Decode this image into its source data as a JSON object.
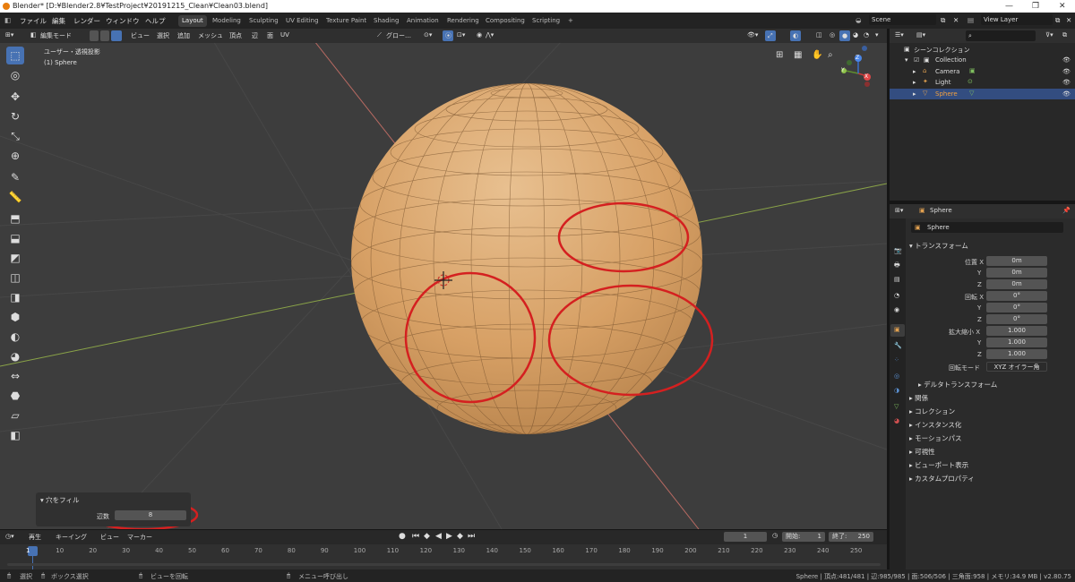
{
  "window": {
    "title": "Blender* [D:¥Blender2.8¥TestProject¥20191215_Clean¥Clean03.blend]"
  },
  "menu": [
    "ファイル",
    "編集",
    "レンダー",
    "ウィンドウ",
    "ヘルプ"
  ],
  "workspaces": [
    {
      "label": "Layout",
      "active": true
    },
    {
      "label": "Modeling"
    },
    {
      "label": "Sculpting"
    },
    {
      "label": "UV Editing"
    },
    {
      "label": "Texture Paint"
    },
    {
      "label": "Shading"
    },
    {
      "label": "Animation"
    },
    {
      "label": "Rendering"
    },
    {
      "label": "Compositing"
    },
    {
      "label": "Scripting"
    },
    {
      "label": "+"
    }
  ],
  "scene": "Scene",
  "view_layer": "View Layer",
  "viewport": {
    "mode": "編集モード",
    "menus": [
      "ビュー",
      "選択",
      "追加",
      "メッシュ",
      "頂点",
      "辺",
      "面",
      "UV"
    ],
    "orientation": "グロー…",
    "overlay_title": "ユーザー・透視投影",
    "overlay_object": "(1) Sphere",
    "gizmo": {
      "x": "X",
      "y": "Y",
      "z": "Z"
    }
  },
  "tools": [
    "select-box",
    "cursor",
    "move",
    "rotate",
    "scale",
    "transform",
    "annotate",
    "measure",
    "extrude",
    "inset",
    "bevel",
    "loop-cut",
    "knife",
    "poly-build",
    "spin",
    "smooth",
    "edge-slide",
    "shrink",
    "shear",
    "rip"
  ],
  "fill_panel": {
    "title": "穴をフィル",
    "label": "辺数",
    "value": "8"
  },
  "outliner": {
    "root": "シーンコレクション",
    "collection": "Collection",
    "items": [
      {
        "name": "Camera",
        "color": "#d0d0d0"
      },
      {
        "name": "Light",
        "color": "#d0d0d0"
      },
      {
        "name": "Sphere",
        "color": "#f0a040"
      }
    ]
  },
  "properties": {
    "header": "Sphere",
    "object_name": "Sphere",
    "section_transform": "トランスフォーム",
    "location_label": "位置 X",
    "rotation_label": "回転 X",
    "scale_label": "拡大縮小 X",
    "y": "Y",
    "z": "Z",
    "location": [
      "0m",
      "0m",
      "0m"
    ],
    "rotation": [
      "0°",
      "0°",
      "0°"
    ],
    "scale": [
      "1.000",
      "1.000",
      "1.000"
    ],
    "rotation_mode_label": "回転モード",
    "rotation_mode": "XYZ オイラー角",
    "delta": "デルタトランスフォーム",
    "sections": [
      "関係",
      "コレクション",
      "インスタンス化",
      "モーションパス",
      "可視性",
      "ビューポート表示",
      "カスタムプロパティ"
    ]
  },
  "timeline": {
    "menus": [
      "再生",
      "キーイング",
      "ビュー",
      "マーカー"
    ],
    "current": "1",
    "start_label": "開始:",
    "start": "1",
    "end_label": "終了:",
    "end": "250",
    "ticks": [
      "1",
      "10",
      "20",
      "30",
      "40",
      "50",
      "60",
      "70",
      "80",
      "90",
      "100",
      "110",
      "120",
      "130",
      "140",
      "150",
      "160",
      "170",
      "180",
      "190",
      "200",
      "210",
      "220",
      "230",
      "240",
      "250"
    ]
  },
  "status": {
    "left": [
      "選択",
      "ボックス選択",
      "ビューを回転",
      "メニュー呼び出し"
    ],
    "right": "Sphere | 頂点:481/481 | 辺:985/985 | 面:506/506 | 三角面:958 | メモリ:34.9 MB | v2.80.75"
  },
  "colors": {
    "accent": "#4772b3",
    "sphere": "#d9a36a",
    "annotation": "#d42020",
    "x_axis": "#c8706a",
    "y_axis": "#94b84a"
  }
}
